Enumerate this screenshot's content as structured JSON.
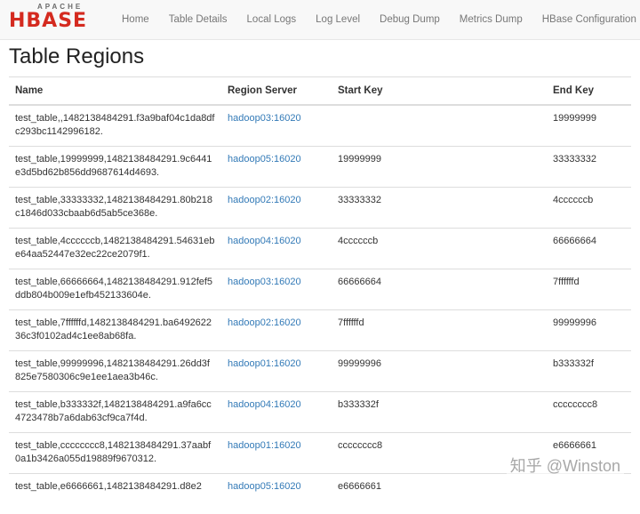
{
  "logo": {
    "small": "APACHE",
    "big": "HBASE"
  },
  "nav": [
    "Home",
    "Table Details",
    "Local Logs",
    "Log Level",
    "Debug Dump",
    "Metrics Dump",
    "HBase Configuration"
  ],
  "page_title": "Table Regions",
  "table": {
    "headers": [
      "Name",
      "Region Server",
      "Start Key",
      "End Key"
    ],
    "rows": [
      {
        "name": "test_table,,1482138484291.f3a9baf04c1da8dfc293bc1142996182.",
        "server": "hadoop03:16020",
        "start": "",
        "end": "19999999"
      },
      {
        "name": "test_table,19999999,1482138484291.9c6441e3d5bd62b856dd9687614d4693.",
        "server": "hadoop05:16020",
        "start": "19999999",
        "end": "33333332"
      },
      {
        "name": "test_table,33333332,1482138484291.80b218c1846d033cbaab6d5ab5ce368e.",
        "server": "hadoop02:16020",
        "start": "33333332",
        "end": "4ccccccb"
      },
      {
        "name": "test_table,4ccccccb,1482138484291.54631ebe64aa52447e32ec22ce2079f1.",
        "server": "hadoop04:16020",
        "start": "4ccccccb",
        "end": "66666664"
      },
      {
        "name": "test_table,66666664,1482138484291.912fef5ddb804b009e1efb452133604e.",
        "server": "hadoop03:16020",
        "start": "66666664",
        "end": "7ffffffd"
      },
      {
        "name": "test_table,7ffffffd,1482138484291.ba649262236c3f0102ad4c1ee8ab68fa.",
        "server": "hadoop02:16020",
        "start": "7ffffffd",
        "end": "99999996"
      },
      {
        "name": "test_table,99999996,1482138484291.26dd3f825e7580306c9e1ee1aea3b46c.",
        "server": "hadoop01:16020",
        "start": "99999996",
        "end": "b333332f"
      },
      {
        "name": "test_table,b333332f,1482138484291.a9fa6cc4723478b7a6dab63cf9ca7f4d.",
        "server": "hadoop04:16020",
        "start": "b333332f",
        "end": "cccccccc8"
      },
      {
        "name": "test_table,cccccccc8,1482138484291.37aabf0a1b3426a055d19889f9670312.",
        "server": "hadoop01:16020",
        "start": "cccccccc8",
        "end": "e6666661"
      },
      {
        "name": "test_table,e6666661,1482138484291.d8e2",
        "server": "hadoop05:16020",
        "start": "e6666661",
        "end": ""
      }
    ]
  },
  "watermark": "知乎 @Winston"
}
